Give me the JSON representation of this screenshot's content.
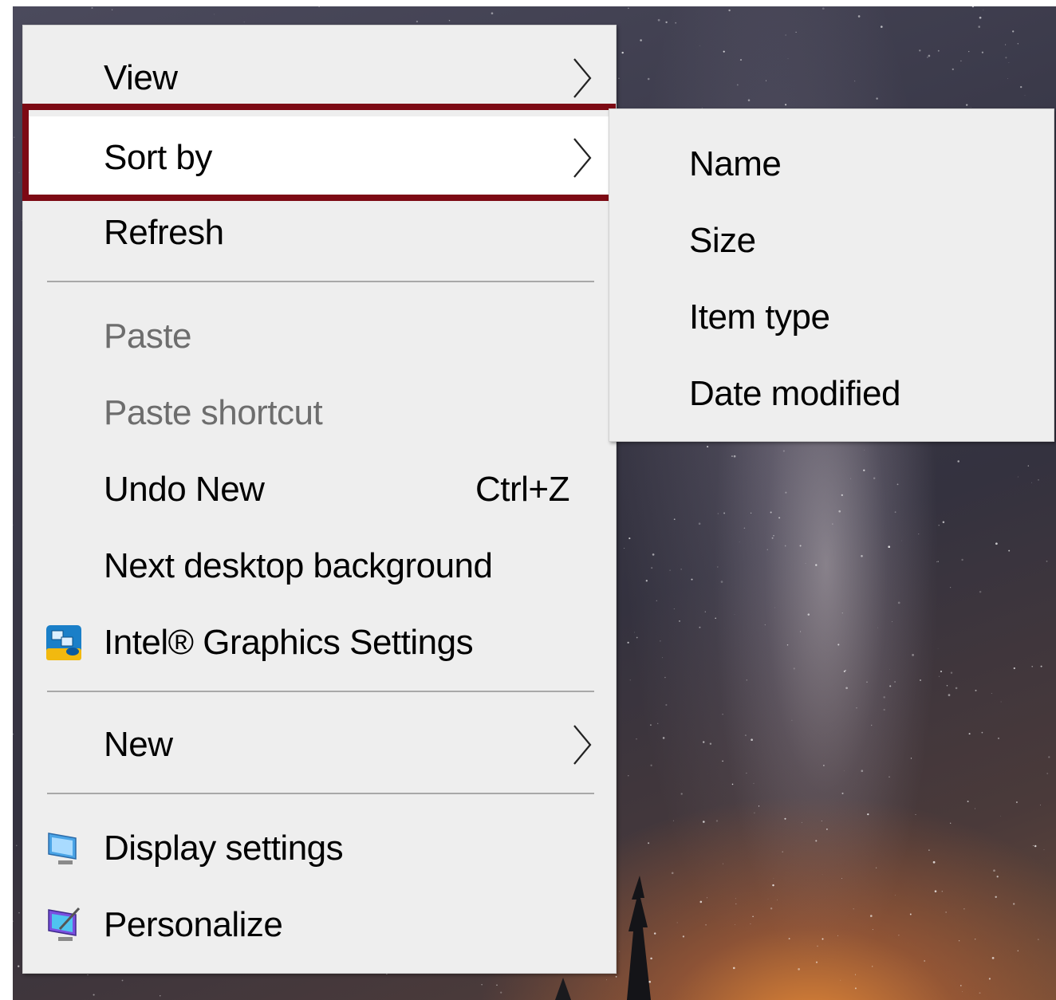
{
  "desktop": {
    "wallpaper_description_colors": {
      "sky": "#3a3949",
      "glow": "#eb8c37"
    }
  },
  "main_menu": {
    "items": [
      {
        "label": "View",
        "has_submenu": true,
        "disabled": false
      },
      {
        "label": "Sort by",
        "has_submenu": true,
        "disabled": false,
        "highlighted": true
      },
      {
        "label": "Refresh",
        "has_submenu": false,
        "disabled": false
      },
      {
        "label": "Paste",
        "has_submenu": false,
        "disabled": true
      },
      {
        "label": "Paste shortcut",
        "has_submenu": false,
        "disabled": true
      },
      {
        "label": "Undo New",
        "shortcut": "Ctrl+Z",
        "has_submenu": false,
        "disabled": false
      },
      {
        "label": "Next desktop background",
        "has_submenu": false,
        "disabled": false
      },
      {
        "label": "Intel® Graphics Settings",
        "icon": "intel-graphics-icon",
        "has_submenu": false,
        "disabled": false
      },
      {
        "label": "New",
        "has_submenu": true,
        "disabled": false
      },
      {
        "label": "Display settings",
        "icon": "display-settings-icon",
        "has_submenu": false,
        "disabled": false
      },
      {
        "label": "Personalize",
        "icon": "personalize-icon",
        "has_submenu": false,
        "disabled": false
      }
    ]
  },
  "sort_submenu": {
    "items": [
      {
        "label": "Name"
      },
      {
        "label": "Size"
      },
      {
        "label": "Item type"
      },
      {
        "label": "Date modified"
      }
    ]
  },
  "colors": {
    "menu_bg": "#eeeeee",
    "highlight_bg": "#ffffff",
    "highlight_border": "#7d0a14",
    "disabled_text": "#6d6d6d",
    "separator": "#a8a8a8"
  }
}
